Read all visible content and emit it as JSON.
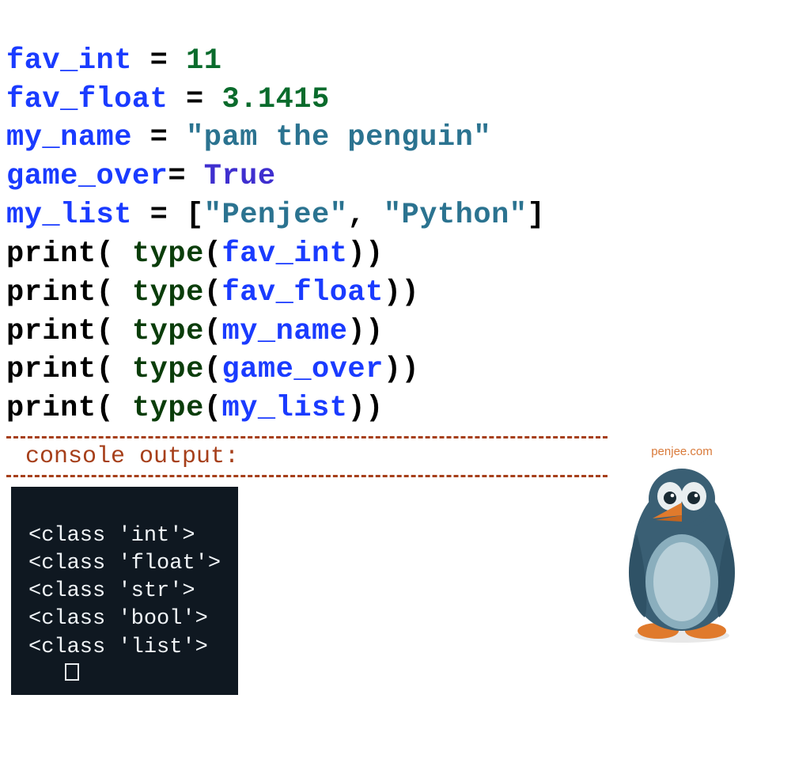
{
  "code": {
    "l1_var": "fav_int",
    "l1_eq": " = ",
    "l1_val": "11",
    "l2_var": "fav_float",
    "l2_eq": " = ",
    "l2_val": "3.1415",
    "l3_var": "my_name",
    "l3_eq": " = ",
    "l3_val": "\"pam the penguin\"",
    "l4_var": "game_over",
    "l4_eq": "= ",
    "l4_val": "True",
    "l5_var": "my_list",
    "l5_eq": " = ",
    "l5_br1": "[",
    "l5_s1": "\"Penjee\"",
    "l5_comma": ", ",
    "l5_s2": "\"Python\"",
    "l5_br2": "]",
    "p_print": "print",
    "p_open": "( ",
    "p_openTight": "(",
    "p_type": "type",
    "p_close": "))",
    "a1": "fav_int",
    "a2": "fav_float",
    "a3": "my_name",
    "a4": "game_over",
    "a5": "my_list"
  },
  "console_label": "console output:",
  "output": {
    "l1": "<class 'int'>",
    "l2": "<class 'float'>",
    "l3": "<class 'str'>",
    "l4": "<class 'bool'>",
    "l5": "<class 'list'>"
  },
  "mascot": {
    "site": "penjee.com"
  }
}
